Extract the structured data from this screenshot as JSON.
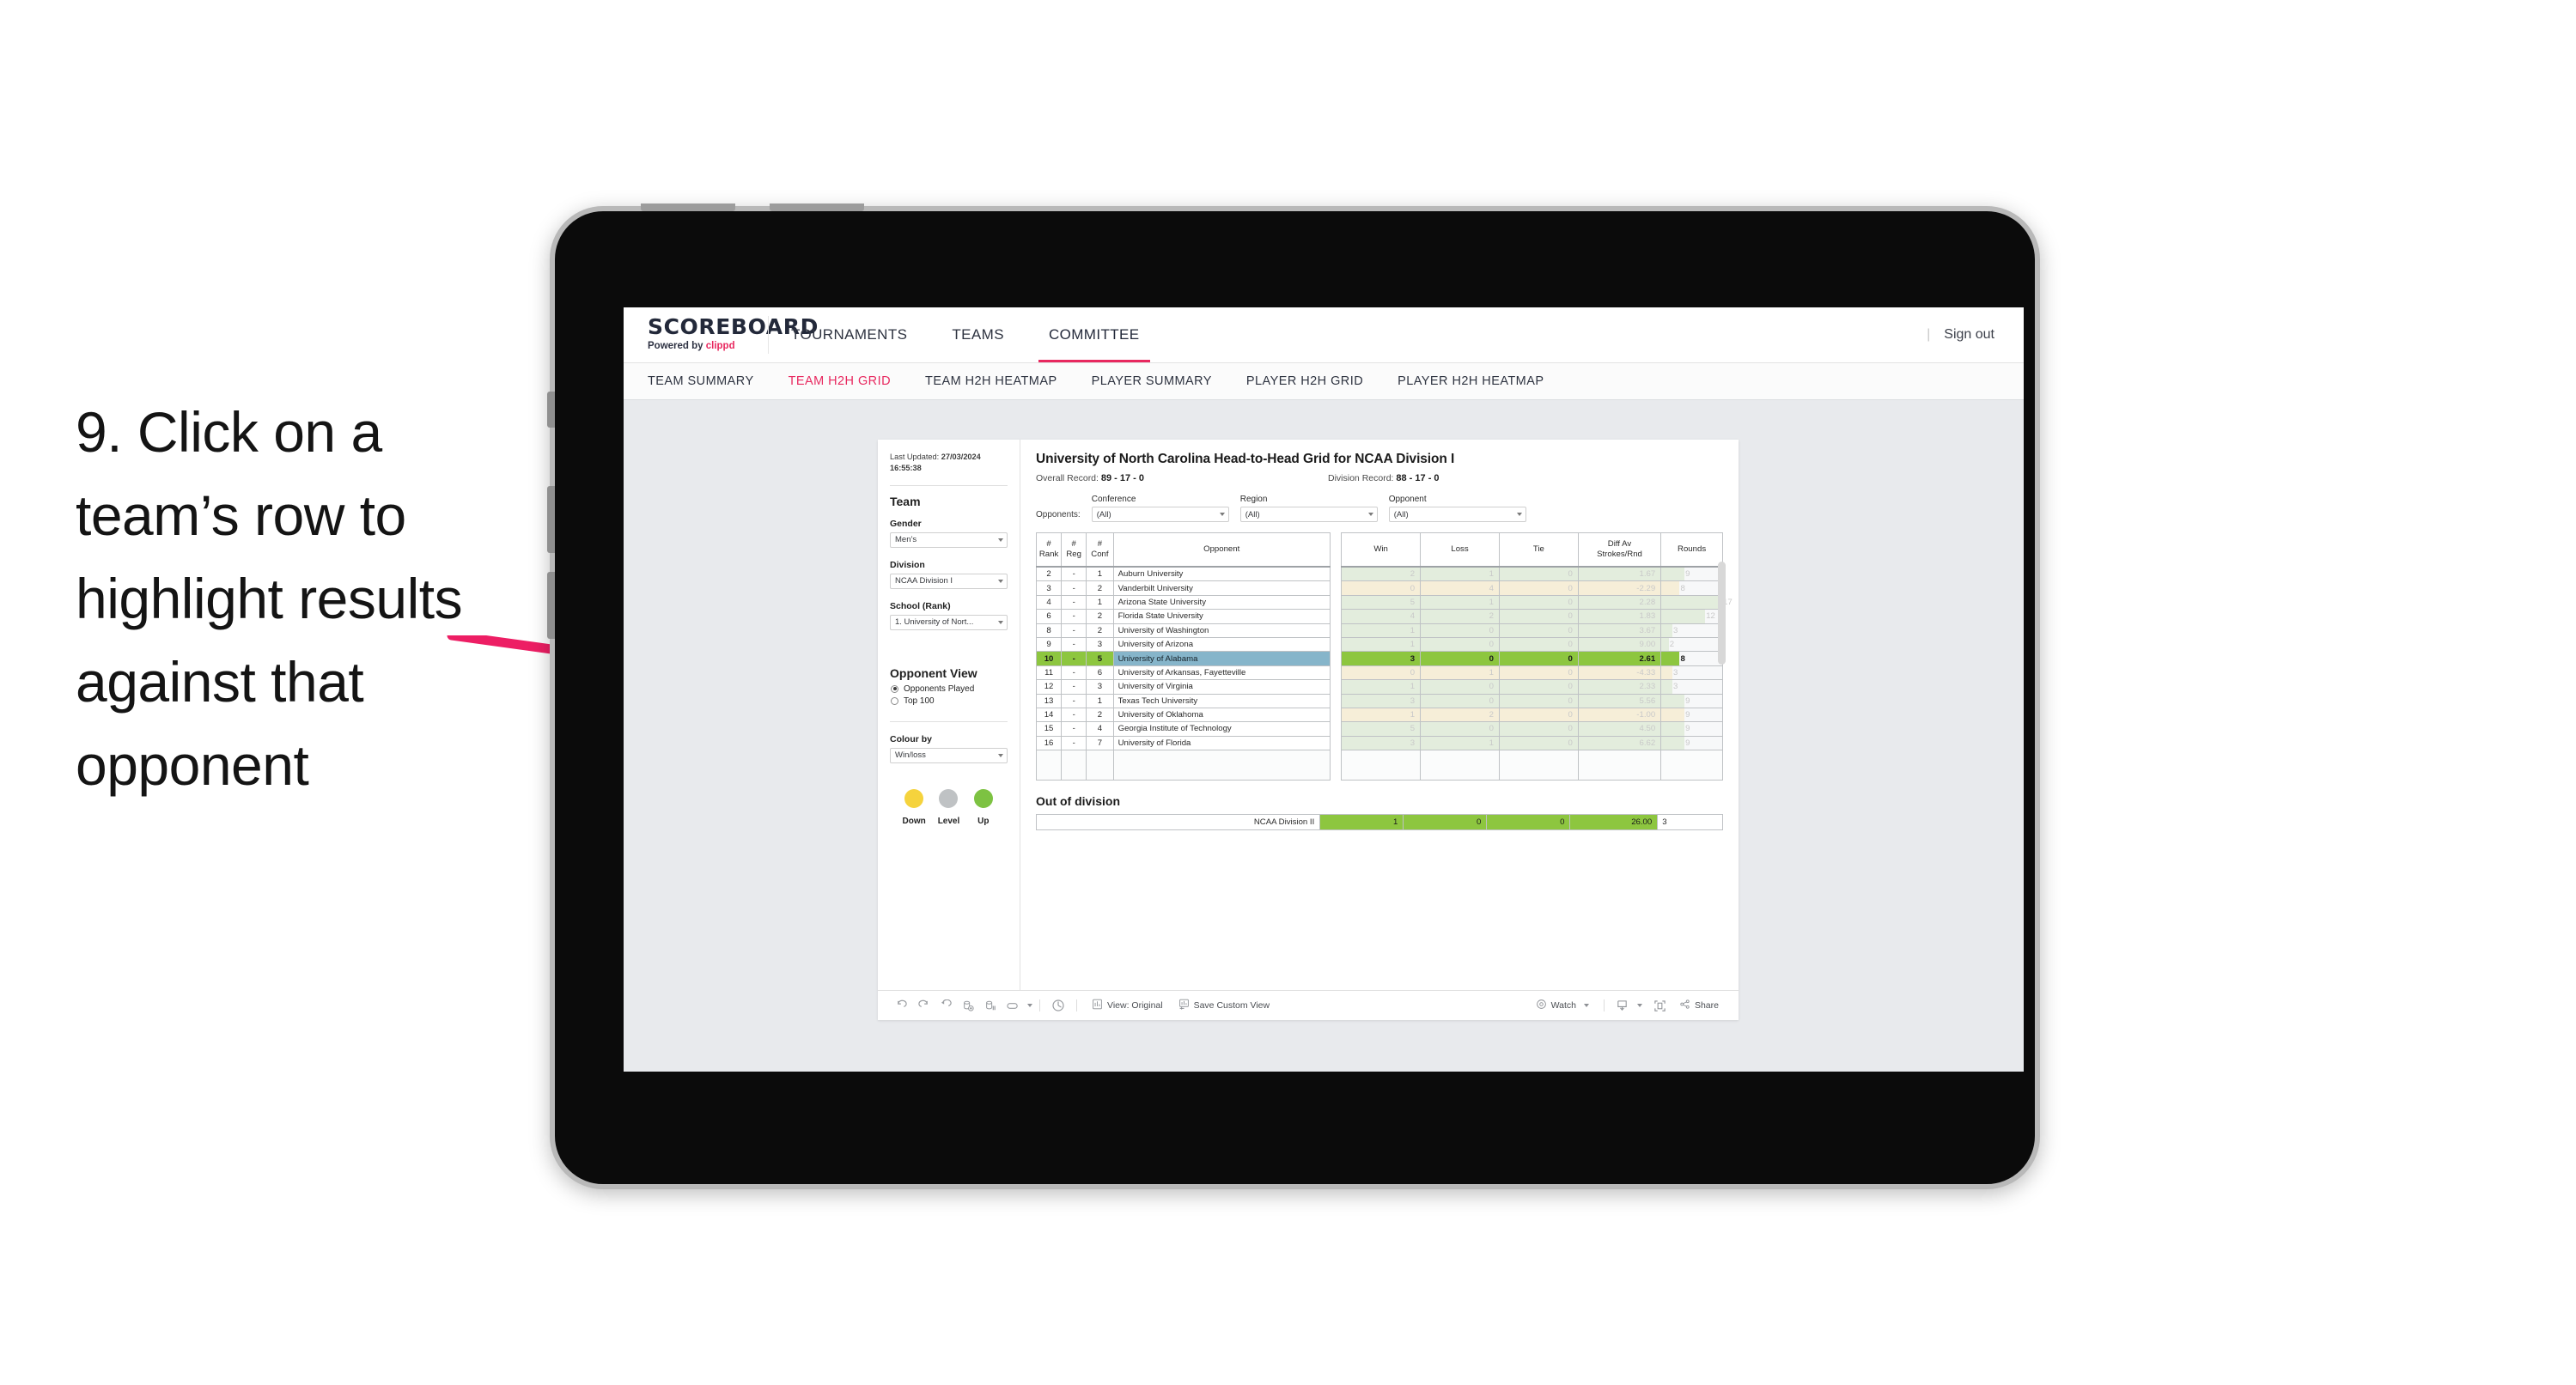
{
  "annotation": {
    "text": "9. Click on a team’s row to highlight results against that opponent",
    "arrow_color": "#ED1E64"
  },
  "app": {
    "brand": {
      "title": "SCOREBOARD",
      "powered_prefix": "Powered by ",
      "powered_brand": "clippd"
    },
    "top_nav": [
      {
        "label": "TOURNAMENTS",
        "active": false
      },
      {
        "label": "TEAMS",
        "active": false
      },
      {
        "label": "COMMITTEE",
        "active": true
      }
    ],
    "top_right": {
      "divider": "|",
      "sign_out": "Sign out"
    },
    "sub_nav": [
      {
        "label": "TEAM SUMMARY",
        "active": false
      },
      {
        "label": "TEAM H2H GRID",
        "active": true
      },
      {
        "label": "TEAM H2H HEATMAP",
        "active": false
      },
      {
        "label": "PLAYER SUMMARY",
        "active": false
      },
      {
        "label": "PLAYER H2H GRID",
        "active": false
      },
      {
        "label": "PLAYER H2H HEATMAP",
        "active": false
      }
    ]
  },
  "sidebar": {
    "last_updated_label": "Last Updated:",
    "last_updated_date": "27/03/2024",
    "last_updated_time": "16:55:38",
    "team_heading": "Team",
    "gender": {
      "label": "Gender",
      "value": "Men’s"
    },
    "division": {
      "label": "Division",
      "value": "NCAA Division I"
    },
    "school": {
      "label": "School (Rank)",
      "value": "1. University of Nort..."
    },
    "opponent_view": {
      "heading": "Opponent View",
      "options": [
        {
          "label": "Opponents Played",
          "selected": true
        },
        {
          "label": "Top 100",
          "selected": false
        }
      ]
    },
    "colour_by": {
      "label": "Colour by",
      "value": "Win/loss"
    },
    "legend": [
      {
        "label": "Down",
        "color": "#F5D33D"
      },
      {
        "label": "Level",
        "color": "#BFC2C4"
      },
      {
        "label": "Up",
        "color": "#7DC242"
      }
    ]
  },
  "main": {
    "title": "University of North Carolina Head-to-Head Grid for NCAA Division I",
    "overall_record_label": "Overall Record:",
    "overall_record_value": "89 - 17 - 0",
    "division_record_label": "Division Record:",
    "division_record_value": "88 - 17 - 0",
    "opponents_label": "Opponents:",
    "filters": [
      {
        "caption": "Conference",
        "value": "(All)"
      },
      {
        "caption": "Region",
        "value": "(All)"
      },
      {
        "caption": "Opponent",
        "value": "(All)"
      }
    ],
    "table": {
      "headers": [
        "# Rank",
        "# Reg",
        "# Conf",
        "Opponent",
        "Win",
        "Loss",
        "Tie",
        "Diff Av Strokes/Rnd",
        "Rounds"
      ],
      "header_lines": [
        [
          "#",
          "Rank"
        ],
        [
          "#",
          "Reg"
        ],
        [
          "#",
          "Conf"
        ],
        [
          "Opponent",
          ""
        ],
        [
          "Win",
          ""
        ],
        [
          "Loss",
          ""
        ],
        [
          "Tie",
          ""
        ],
        [
          "Diff Av",
          "Strokes/Rnd"
        ],
        [
          "Rounds",
          ""
        ]
      ],
      "rows": [
        {
          "rank": "2",
          "reg": "-",
          "conf": "1",
          "opponent": "Auburn University",
          "win": "2",
          "loss": "1",
          "tie": "0",
          "diff": "1.67",
          "rounds": "9",
          "result": "win",
          "selected": false,
          "bar": 38
        },
        {
          "rank": "3",
          "reg": "-",
          "conf": "2",
          "opponent": "Vanderbilt University",
          "win": "0",
          "loss": "4",
          "tie": "0",
          "diff": "-2.29",
          "rounds": "8",
          "result": "loss",
          "selected": false,
          "bar": 30
        },
        {
          "rank": "4",
          "reg": "-",
          "conf": "1",
          "opponent": "Arizona State University",
          "win": "5",
          "loss": "1",
          "tie": "0",
          "diff": "2.28",
          "rounds": "17",
          "result": "win",
          "selected": false,
          "bar": 100
        },
        {
          "rank": "6",
          "reg": "-",
          "conf": "2",
          "opponent": "Florida State University",
          "win": "4",
          "loss": "2",
          "tie": "0",
          "diff": "1.83",
          "rounds": "12",
          "result": "win",
          "selected": false,
          "bar": 72
        },
        {
          "rank": "8",
          "reg": "-",
          "conf": "2",
          "opponent": "University of Washington",
          "win": "1",
          "loss": "0",
          "tie": "0",
          "diff": "3.67",
          "rounds": "3",
          "result": "win",
          "selected": false,
          "bar": 18
        },
        {
          "rank": "9",
          "reg": "-",
          "conf": "3",
          "opponent": "University of Arizona",
          "win": "1",
          "loss": "0",
          "tie": "0",
          "diff": "9.00",
          "rounds": "2",
          "result": "win",
          "selected": false,
          "bar": 12
        },
        {
          "rank": "10",
          "reg": "-",
          "conf": "5",
          "opponent": "University of Alabama",
          "win": "3",
          "loss": "0",
          "tie": "0",
          "diff": "2.61",
          "rounds": "8",
          "result": "win",
          "selected": true,
          "bar": 30
        },
        {
          "rank": "11",
          "reg": "-",
          "conf": "6",
          "opponent": "University of Arkansas, Fayetteville",
          "win": "0",
          "loss": "1",
          "tie": "0",
          "diff": "-4.33",
          "rounds": "3",
          "result": "loss",
          "selected": false,
          "bar": 18
        },
        {
          "rank": "12",
          "reg": "-",
          "conf": "3",
          "opponent": "University of Virginia",
          "win": "1",
          "loss": "0",
          "tie": "0",
          "diff": "2.33",
          "rounds": "3",
          "result": "win",
          "selected": false,
          "bar": 18
        },
        {
          "rank": "13",
          "reg": "-",
          "conf": "1",
          "opponent": "Texas Tech University",
          "win": "3",
          "loss": "0",
          "tie": "0",
          "diff": "5.56",
          "rounds": "9",
          "result": "win",
          "selected": false,
          "bar": 38
        },
        {
          "rank": "14",
          "reg": "-",
          "conf": "2",
          "opponent": "University of Oklahoma",
          "win": "1",
          "loss": "2",
          "tie": "0",
          "diff": "-1.00",
          "rounds": "9",
          "result": "loss",
          "selected": false,
          "bar": 38
        },
        {
          "rank": "15",
          "reg": "-",
          "conf": "4",
          "opponent": "Georgia Institute of Technology",
          "win": "5",
          "loss": "0",
          "tie": "0",
          "diff": "4.50",
          "rounds": "9",
          "result": "win",
          "selected": false,
          "bar": 38
        },
        {
          "rank": "16",
          "reg": "-",
          "conf": "7",
          "opponent": "University of Florida",
          "win": "3",
          "loss": "1",
          "tie": "0",
          "diff": "6.62",
          "rounds": "9",
          "result": "win",
          "selected": false,
          "bar": 38
        }
      ]
    },
    "out_of_division": {
      "heading": "Out of division",
      "row": {
        "name": "NCAA Division II",
        "win": "1",
        "loss": "0",
        "tie": "0",
        "diff": "26.00",
        "rounds": "3"
      }
    }
  },
  "toolbar": {
    "icons": [
      "undo-icon",
      "redo-icon",
      "revert-icon",
      "refresh-icon",
      "pause-icon",
      "loop-icon"
    ],
    "view_label": "View: Original",
    "save_custom_view_label": "Save Custom View",
    "watch_label": "Watch",
    "share_label": "Share"
  }
}
